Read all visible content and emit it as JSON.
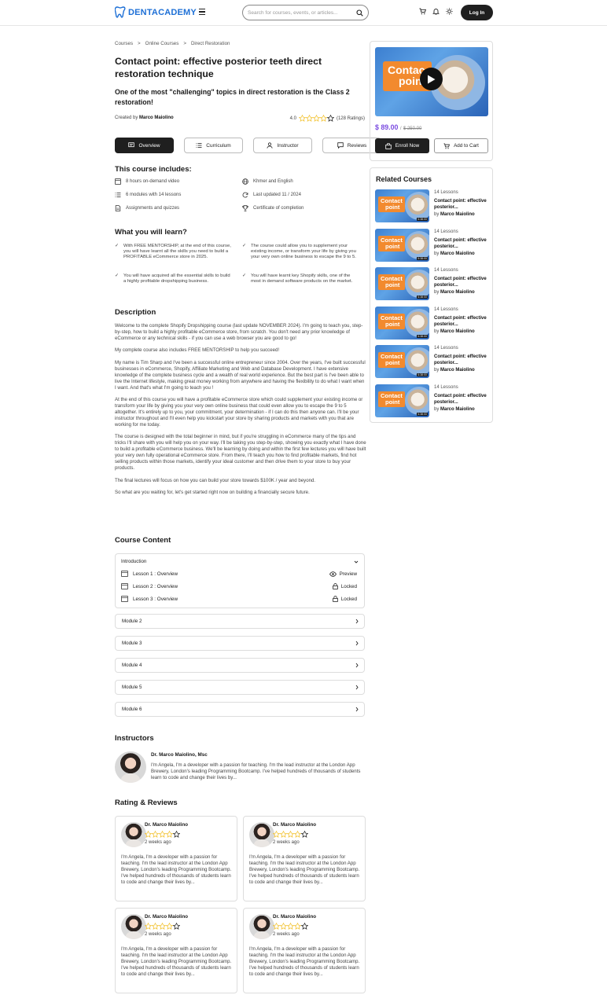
{
  "header": {
    "brand": "DENTACADEMY",
    "search_placeholder": "Search for courses, events, or articles...",
    "login_label": "Log In"
  },
  "breadcrumb": [
    "Courses",
    "Online Courses",
    "Direct Restoration"
  ],
  "course": {
    "title": "Contact point: effective posterior teeth direct restoration technique",
    "subtitle": "One of the most \"challenging\" topics in direct restoration is the Class 2 restoration!",
    "created_by_label": "Created by",
    "author": "Marco Maiolino",
    "rating_value": "4.0",
    "rating_stars": 4,
    "rating_count": "(128 Ratings)"
  },
  "tabs": [
    {
      "label": "Overview",
      "active": true
    },
    {
      "label": "Curriculum"
    },
    {
      "label": "Instructor"
    },
    {
      "label": "Reviews"
    }
  ],
  "includes": {
    "heading": "This course includes:",
    "items": [
      {
        "label": "8 hours on-demand video",
        "icon": "video-icon"
      },
      {
        "label": "Khmer and English",
        "icon": "globe-icon"
      },
      {
        "label": "6 modules with 14 lessons",
        "icon": "list-icon"
      },
      {
        "label": "Last updated 11 / 2024",
        "icon": "refresh-icon"
      },
      {
        "label": "Assignments and quizzes",
        "icon": "document-icon"
      },
      {
        "label": "Certificate of completion",
        "icon": "trophy-icon"
      }
    ]
  },
  "learn": {
    "heading": "What you will learn?",
    "items": [
      "With FREE MENTORSHIP, at the end of this course, you will have learnt all the skills you need to build a PROFITABLE eCommerce store in 2025.",
      "The course could allow you to supplement your existing income, or transform your life by giving you your very own online business to escape the 9 to 5.",
      "You will have acquired all the essential skills to build a highly profitable dropshipping business.",
      "You will have learnt key Shopify skills, one of the most in demand software products on the market."
    ]
  },
  "description": {
    "heading": "Description",
    "paragraphs": [
      "Welcome to the complete Shopify Dropshipping course (last update NOVEMBER 2024). I'm going to teach you, step-by-step, how to build a highly profitable eCommerce store, from scratch. You don't need any prior knowledge of eCommerce or any technical skills - if you can use a web browser you are good to go!",
      "My complete course also includes FREE MENTORSHIP to help you succeed!",
      "My name is Tim Sharp and I've been a successful online entrepreneur since 2004. Over the years, I've built successful businesses in eCommerce, Shopify, Affiliate Marketing and Web and Database Development. I have extensive knowledge of the complete business cycle and a wealth of real world experience. But the best part is I've been able to live the Internet lifestyle, making great money working from anywhere and having the flexibility to do what I want when I want. And that's what I'm going to teach you !",
      "At the end of this course you will have a profitable eCommerce store which could supplement your existing income or transform your life by giving you your very own online business that could even allow you to escape the 9 to 5 altogether. It's entirely up to you, your commitment, your determination - if I can do this then anyone can. I'll be your instructor throughout and I'll even help you kickstart your store by sharing products and markets with you that are working for me today.",
      "The course is designed with the total beginner in mind, but if you're struggling in eCommerce many of the tips and tricks I'll share with you will help you on your way. I'll be taking you step-by-step, showing you exactly what I have done to build a profitable eCommerce business. We'll be learning by doing and within the first few lectures you will have built your very own fully operational eCommerce store. From there, I'll teach you how to find profitable markets, find hot selling products within those markets, identify your ideal customer and then drive them to your store to buy your products.",
      "The final lectures will focus on how you can build your store towards $100K / year and beyond.",
      "So what are you waiting for, let's get started right now on building a financially secure future."
    ]
  },
  "content": {
    "heading": "Course Content",
    "intro_label": "Introduction",
    "lessons": [
      {
        "label": "Lesson 1 : Overview",
        "status": "Preview",
        "icon": "eye-icon"
      },
      {
        "label": "Lesson 2 : Overview",
        "status": "Locked",
        "icon": "lock-icon"
      },
      {
        "label": "Lesson 3 : Overview",
        "status": "Locked",
        "icon": "lock-icon"
      }
    ],
    "modules": [
      "Module 2",
      "Module 3",
      "Module 4",
      "Module 5",
      "Module 6"
    ]
  },
  "instructors": {
    "heading": "Instructors",
    "name": "Dr. Marco Maiolino, Msc",
    "bio": "I'm Angela, I'm a developer with a passion for teaching. I'm the lead instructor at the London App Brewery, London's leading Programming Bootcamp. I've helped hundreds of thousands of students learn to code and change their lives by..."
  },
  "reviews": {
    "heading": "Rating & Reviews",
    "items": [
      {
        "name": "Dr. Marco Maiolino",
        "stars": 4,
        "ago": "2 weeks ago",
        "text": "I'm Angela, I'm a developer with a passion for teaching. I'm the lead instructor at the London App Brewery, London's leading Programming Bootcamp. I've helped hundreds of thousands of students learn to code and change their lives by..."
      },
      {
        "name": "Dr. Marco Maiolino",
        "stars": 4,
        "ago": "2 weeks ago",
        "text": "I'm Angela, I'm a developer with a passion for teaching. I'm the lead instructor at the London App Brewery, London's leading Programming Bootcamp. I've helped hundreds of thousands of students learn to code and change their lives by..."
      },
      {
        "name": "Dr. Marco Maiolino",
        "stars": 4,
        "ago": "2 weeks ago",
        "text": "I'm Angela, I'm a developer with a passion for teaching. I'm the lead instructor at the London App Brewery, London's leading Programming Bootcamp. I've helped hundreds of thousands of students learn to code and change their lives by..."
      },
      {
        "name": "Dr. Marco Maiolino",
        "stars": 4,
        "ago": "2 weeks ago",
        "text": "I'm Angela, I'm a developer with a passion for teaching. I'm the lead instructor at the London App Brewery, London's leading Programming Bootcamp. I've helped hundreds of thousands of students learn to code and change their lives by..."
      }
    ]
  },
  "purchase": {
    "thumb_line1": "Contac",
    "thumb_line2": "point",
    "price": "$ 89.00",
    "separator": "/",
    "old_price": "$ 250.00",
    "enroll_label": "Enroll Now",
    "cart_label": "Add to Cart"
  },
  "related": {
    "heading": "Related Courses",
    "thumb_line1": "Contact",
    "thumb_line2": "point",
    "duration": "6:38:00",
    "by_label": "by",
    "items": [
      {
        "lessons": "14 Lessons",
        "title": "Contact point: effective posterior...",
        "author": "Marco Maiolino"
      },
      {
        "lessons": "14 Lessons",
        "title": "Contact point: effective posterior...",
        "author": "Marco Maiolino"
      },
      {
        "lessons": "14 Lessons",
        "title": "Contact point: effective posterior...",
        "author": "Marco Maiolino"
      },
      {
        "lessons": "14 Lessons",
        "title": "Contact point: effective posterior...",
        "author": "Marco Maiolino"
      },
      {
        "lessons": "14 Lessons",
        "title": "Contact point: effective posterior...",
        "author": "Marco Maiolino"
      },
      {
        "lessons": "14 Lessons",
        "title": "Contact point: effective posterior...",
        "author": "Marco Maiolino"
      }
    ]
  },
  "colors": {
    "brand": "#1d6fd6",
    "price": "#7b4ce0",
    "star": "#f2c230",
    "dark_button": "#1f1f1f",
    "thumb_orange": "#f28a2e"
  }
}
